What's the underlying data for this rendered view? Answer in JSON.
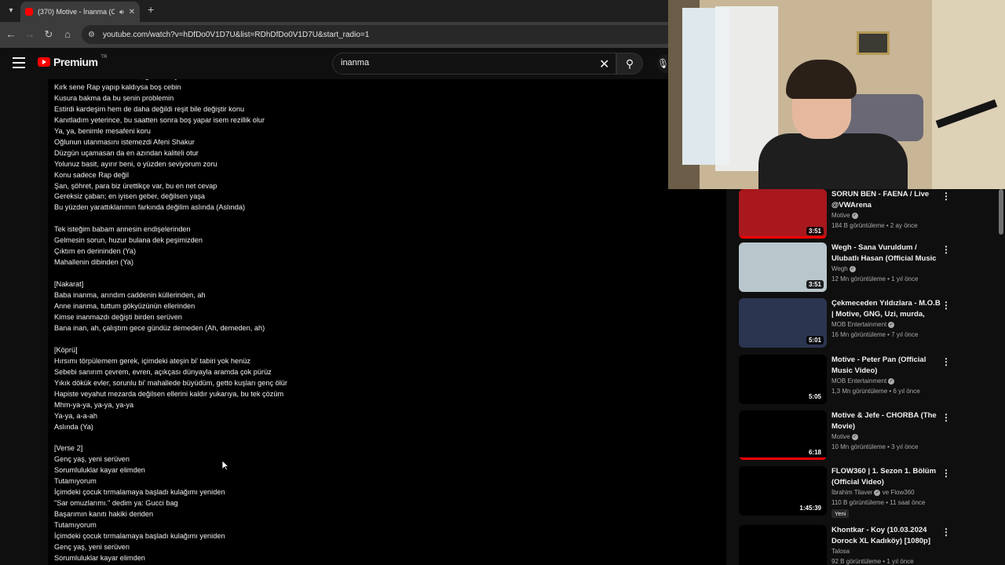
{
  "browser": {
    "tab_title": "(370) Motive - İnanma (Offi",
    "url": "youtube.com/watch?v=hDfDo0V1D7U&list=RDhDfDo0V1D7U&start_radio=1"
  },
  "header": {
    "logo_text": "Premium",
    "logo_region": "TR",
    "search_value": "inanma"
  },
  "lyrics": "Yazmakta zorlanıdım verse, getto niteyimelırm\nKırk sene Rap yapıp kaldıysa boş cebin\nKusura bakma da bu senin problemin\nEstirdi kardeşim hem de daha değildi reşit bile değiştir konu\nKanıtladım yeterince, bu saatten sonra boş yapar isem rezillik olur\nYa, ya, benimle mesafeni koru\nOğlunun utanmasını istemezdi Afeni Shakur\nDüzgün uçamasan da en azından kaliteli otur\nYolunuz basit, ayırır beni, o yüzden seviyorum zoru\nKonu sadece Rap değil\nŞan, şöhret, para biz ürettikçe var, bu en net cevap\nGereksiz çaban; en iyisen geber, değilsen yaşa\nBu yüzden yarattıklarımın farkında değilim aslında (Aslında)\n\nTek isteğim babam annesin endişelerinden\nGelmesin sorun, huzur bulana dek peşimizden\nÇıktım en derininden (Ya)\nMahallenin dibinden (Ya)\n\n[Nakarat]\nBaba inanma, arındım caddenin küllerinden, ah\nAnne inanma, tuttum gökyüzünün ellerinden\nKimse inanmazdı değişti birden serüven\nBana inan, ah, çalıştım gece gündüz demeden (Ah, demeden, ah)\n\n[Köprü]\nHırsımı törpülemem gerek, içimdeki ateşin bi' tabiri yok henüz\nSebebi sanırım çevrem, evren, açıkçası dünyayla aramda çok pürüz\nYıkık dökük evler, sorunlu bi' mahallede büyüdüm, getto kuşları genç ölür\nHapiste veyahut mezarda değilsen ellerini kaldır yukarıya, bu tek çözüm\nMhm-ya-ya, ya-ya, ya-ya\nYa-ya, a-a-ah\nAslında (Ya)\n\n[Verse 2]\nGenç yaş, yeni serüven\nSorumluluklar kayar elimden\nTutamıyorum\nİçimdeki çocuk tırmalamaya başladı kulağımı yeniden\n\"Sar omuzlarımı.\" dedim ya: Gucci bag\nBaşarımın kanıtı hakiki deriden\nTutamıyorum\nİçimdeki çocuk tırmalamaya başladı kulağımı yeniden\nGenç yaş, yeni serüven\nSorumluluklar kayar elimden",
  "sidebar": {
    "videos": [
      {
        "title": "SORUN BEN - FAENA / Live @VWArena",
        "channel": "Motive",
        "verified": true,
        "meta": "184 B görüntüleme • 2 ay önce",
        "duration": "3:51",
        "thumb": "#a8181c",
        "progress": true
      },
      {
        "title": "Wegh - Sana Vuruldum / Ulubatlı Hasan (Official Music ...",
        "channel": "Wegh",
        "verified": true,
        "meta": "12 Mn görüntüleme • 1 yıl önce",
        "duration": "3:51",
        "thumb": "#b9c6cc",
        "progress": false
      },
      {
        "title": "Çekmeceden Yıldızlara - M.O.B | Motive, GNG, Uzi, murda, Burry...",
        "channel": "MOB Entertainment",
        "verified": true,
        "meta": "16 Mn görüntüleme • 7 yıl önce",
        "duration": "5:01",
        "thumb": "#2b3550",
        "progress": false
      },
      {
        "title": "Motive - Peter Pan (Official Music Video)",
        "channel": "MOB Entertainment",
        "verified": true,
        "meta": "1,3 Mn görüntüleme • 6 yıl önce",
        "duration": "5:05",
        "thumb": "#000000",
        "progress": false
      },
      {
        "title": "Motive & Jefe - CHORBA (The Movie)",
        "channel": "Motive",
        "verified": true,
        "meta": "10 Mn görüntüleme • 3 yıl önce",
        "duration": "6:18",
        "thumb": "#000000",
        "progress": true
      },
      {
        "title": "FLOW360 | 1. Sezon 1. Bölüm (Official Video)",
        "channel": "İbrahim Tilaver",
        "channel_extra": "ve Flow360",
        "verified": true,
        "meta": "110 B görüntüleme • 11 saat önce",
        "badge": "Yeni",
        "duration": "1:45:39",
        "thumb": "#000000",
        "progress": false
      },
      {
        "title": "Khontkar - Koy (10.03.2024 Dorock XL Kadıköy) [1080p]",
        "channel": "Talosa",
        "verified": false,
        "meta": "92 B görüntüleme • 1 yıl önce",
        "duration": "",
        "thumb": "#000000",
        "progress": false
      }
    ]
  },
  "colors": {
    "accent": "#ff0000",
    "bg": "#0f0f0f"
  },
  "icons": [
    "tab-list-icon",
    "audio-icon",
    "close-icon",
    "plus-icon",
    "back-icon",
    "forward-icon",
    "reload-icon",
    "home-icon",
    "site-info-icon",
    "menu-icon",
    "youtube-logo-icon",
    "clear-icon",
    "search-icon",
    "mic-icon",
    "more-icon",
    "verified-icon",
    "cursor-icon"
  ]
}
